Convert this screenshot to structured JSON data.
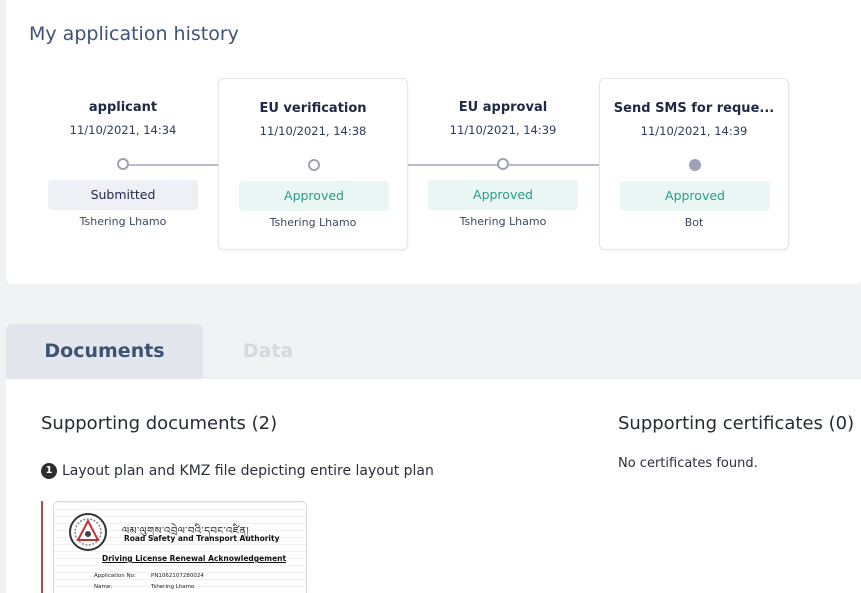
{
  "history": {
    "title": "My application history",
    "steps": [
      {
        "name": "applicant",
        "time": "11/10/2021, 14:34",
        "status": "Submitted",
        "actor": "Tshering Lhamo"
      },
      {
        "name": "EU verification",
        "time": "11/10/2021, 14:38",
        "status": "Approved",
        "actor": "Tshering Lhamo"
      },
      {
        "name": "EU approval",
        "time": "11/10/2021, 14:39",
        "status": "Approved",
        "actor": "Tshering Lhamo"
      },
      {
        "name": "Send SMS for reque...",
        "time": "11/10/2021, 14:39",
        "status": "Approved",
        "actor": "Bot"
      }
    ]
  },
  "tabs": {
    "documents": "Documents",
    "data": "Data"
  },
  "documents": {
    "supporting_title": "Supporting documents (2)",
    "item_number": "1",
    "item_label": "Layout plan and KMZ file depicting entire layout plan",
    "thumbnail": {
      "script_text": "ལམ་ལུགས་འབྲེལ་བའི་དབང་འཛིན།",
      "org": "Road Safety and Transport Authority",
      "heading": "Driving License Renewal Acknowledgement",
      "app_no_label": "Application No:",
      "app_no_value": "PN1062107280024",
      "name_label": "Name:",
      "name_value": "Tshering Lhamo"
    }
  },
  "certificates": {
    "title": "Supporting certificates (0)",
    "empty_text": "No certificates found."
  },
  "colors": {
    "title_blue": "#3e5477",
    "approved_green": "#2a9d86",
    "approved_bg": "#eaf6f4",
    "submitted_bg": "#eef0f6",
    "timeline": "#9ea2b8",
    "doc_border_red": "#c0484c"
  }
}
